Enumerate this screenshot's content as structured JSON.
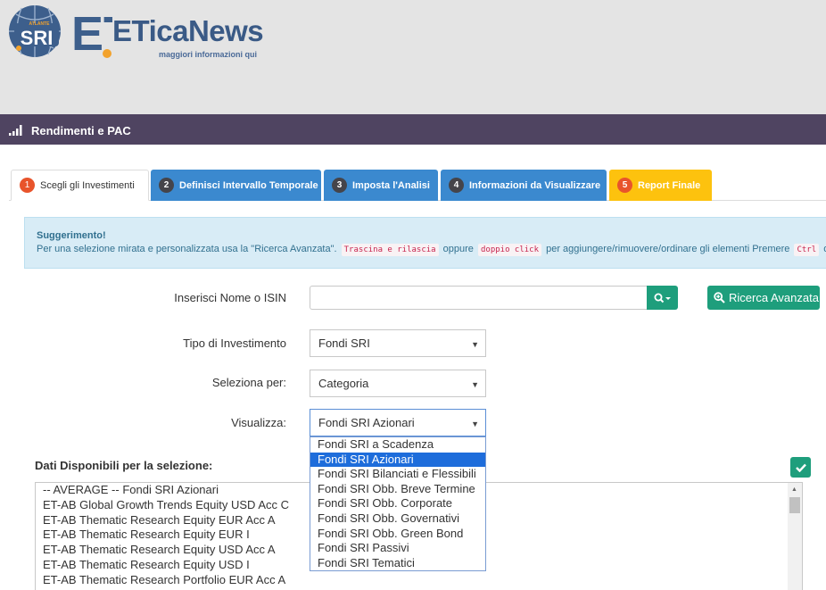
{
  "brand": {
    "badge_top": "ATLANTE",
    "badge_main": "SRI",
    "mark": "ET.",
    "title": "ETicaNews",
    "tagline": "maggiori informazioni qui"
  },
  "titlebar": {
    "title": "Rendimenti e PAC",
    "icon": "signal-bars-icon"
  },
  "tabs": [
    {
      "num": "1",
      "label": "Scegli gli Investimenti"
    },
    {
      "num": "2",
      "label": "Definisci Intervallo Temporale"
    },
    {
      "num": "3",
      "label": "Imposta l'Analisi"
    },
    {
      "num": "4",
      "label": "Informazioni da Visualizzare"
    },
    {
      "num": "5",
      "label": "Report Finale"
    }
  ],
  "hint": {
    "title": "Suggerimento!",
    "text1": "Per una selezione mirata e personalizzata usa la \"Ricerca Avanzata\".",
    "code1": "Trascina e rilascia",
    "text2": "oppure",
    "code2": "doppio click",
    "text3": "per aggiungere/rimuovere/ordinare gli elementi  Premere",
    "code3": "Ctrl",
    "text4": "oppu"
  },
  "form": {
    "search_label": "Inserisci Nome o ISIN",
    "search_value": "",
    "advanced_button": "Ricerca Avanzata",
    "tipo_label": "Tipo di Investimento",
    "tipo_value": "Fondi SRI",
    "seleziona_label": "Seleziona per:",
    "seleziona_value": "Categoria",
    "visualizza_label": "Visualizza:",
    "visualizza_value": "Fondi SRI Azionari"
  },
  "dropdown": {
    "options": [
      "Fondi SRI a Scadenza",
      "Fondi SRI Azionari",
      "Fondi SRI Bilanciati e Flessibili",
      "Fondi SRI Obb. Breve Termine",
      "Fondi SRI Obb. Corporate",
      "Fondi SRI Obb. Governativi",
      "Fondi SRI Obb. Green Bond",
      "Fondi SRI Passivi",
      "Fondi SRI Tematici"
    ],
    "selected_index": 1
  },
  "data_list": {
    "title": "Dati Disponibili per la selezione:",
    "items": [
      "-- AVERAGE -- Fondi SRI Azionari",
      "ET-AB Global Growth Trends Equity USD Acc C",
      "ET-AB Thematic Research Equity EUR Acc A",
      "ET-AB Thematic Research Equity EUR I",
      "ET-AB Thematic Research Equity USD Acc A",
      "ET-AB Thematic Research Equity USD I",
      "ET-AB Thematic Research Portfolio EUR Acc A"
    ]
  },
  "colors": {
    "titlebar": "#4f4461",
    "tab_blue": "#3b89cf",
    "tab_yellow": "#fdc20e",
    "accent_green": "#1e9e7c",
    "step_badge": "#e8542b",
    "selected_option": "#1e6ddb"
  }
}
